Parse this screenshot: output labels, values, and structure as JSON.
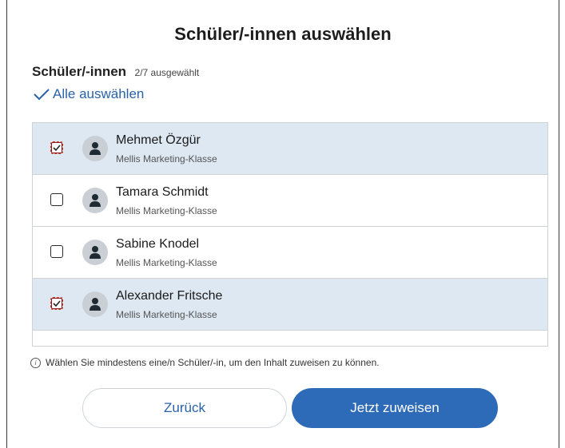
{
  "dialog": {
    "title": "Schüler/-innen auswählen"
  },
  "section": {
    "title": "Schüler/-innen",
    "count": "2/7 ausgewählt",
    "select_all_label": "Alle auswählen"
  },
  "students": [
    {
      "name": "Mehmet Özgür",
      "class": "Mellis Marketing-Klasse",
      "selected": true
    },
    {
      "name": "Tamara Schmidt",
      "class": "Mellis Marketing-Klasse",
      "selected": false
    },
    {
      "name": "Sabine Knodel",
      "class": "Mellis Marketing-Klasse",
      "selected": false
    },
    {
      "name": "Alexander Fritsche",
      "class": "Mellis Marketing-Klasse",
      "selected": true
    }
  ],
  "info": {
    "text": "Wählen Sie mindestens eine/n Schüler/-in, um den Inhalt zuweisen zu können."
  },
  "buttons": {
    "back_label": "Zurück",
    "assign_label": "Jetzt zuweisen"
  },
  "colors": {
    "accent": "#2d6ab7",
    "selected_row": "#dde8f2",
    "link": "#2a62aa"
  }
}
